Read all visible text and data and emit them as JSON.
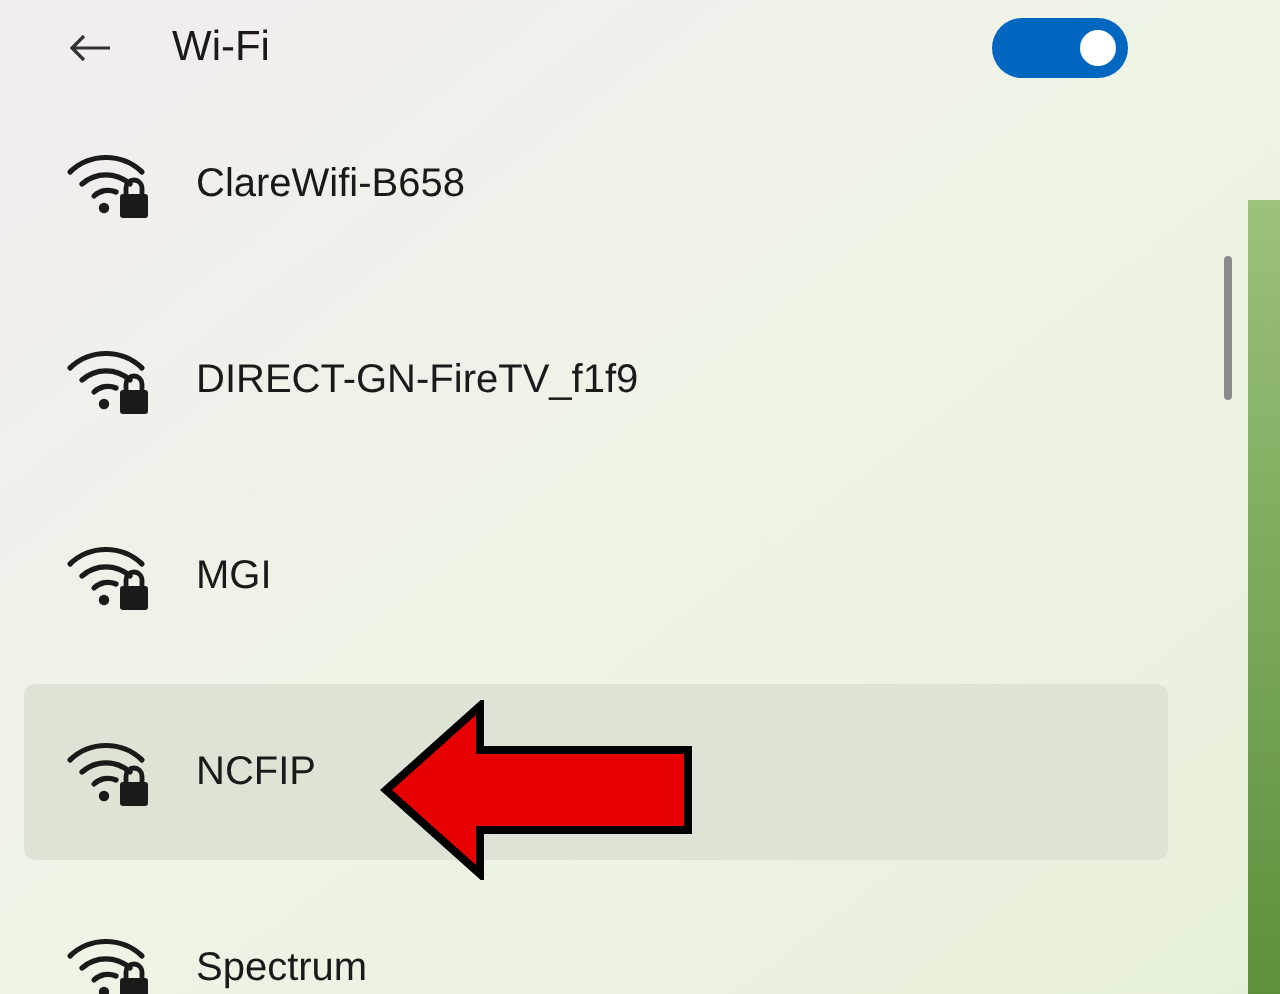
{
  "header": {
    "title": "Wi-Fi",
    "wifi_on": true
  },
  "networks": [
    {
      "name": "ClareWifi-B658",
      "selected": false
    },
    {
      "name": "DIRECT-GN-FireTV_f1f9",
      "selected": false
    },
    {
      "name": "MGI",
      "selected": false
    },
    {
      "name": "NCFIP",
      "selected": true
    },
    {
      "name": "Spectrum",
      "selected": false
    }
  ]
}
